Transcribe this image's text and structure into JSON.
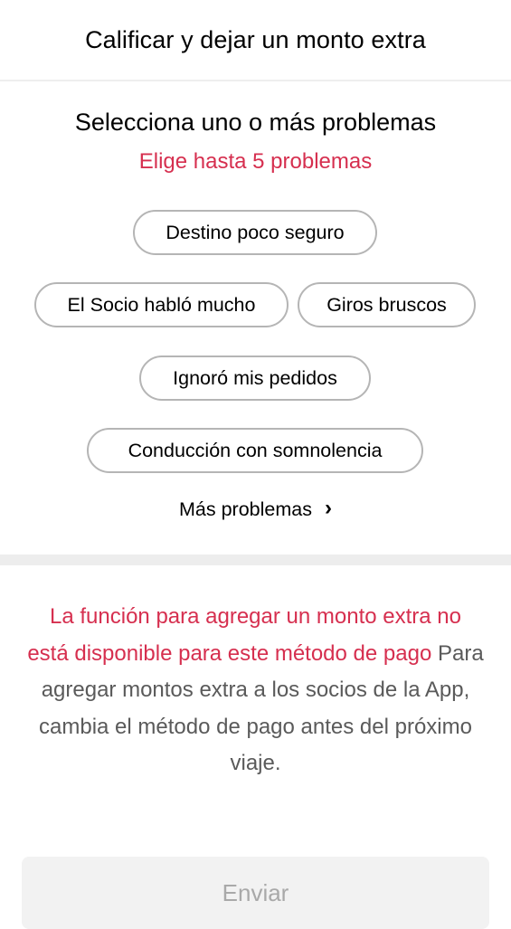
{
  "header": {
    "title": "Calificar y dejar un monto extra"
  },
  "problems": {
    "title": "Selecciona uno o más problemas",
    "subtitle": "Elige hasta 5 problemas",
    "chips": [
      "Destino poco seguro",
      "El Socio habló mucho",
      "Giros bruscos",
      "Ignoró mis pedidos",
      "Conducción con somnolencia"
    ],
    "more_label": "Más problemas",
    "more_icon": "chevron-right-icon"
  },
  "notice": {
    "warning_text": "La función para agregar un monto extra no está disponible para este método de pago",
    "info_text": " Para agregar montos extra a los socios de la App, cambia el método de pago antes del próximo viaje."
  },
  "footer": {
    "submit_label": "Enviar",
    "submit_enabled": false
  },
  "colors": {
    "accent_red": "#d62f4f",
    "chip_border": "#b5b5b5",
    "disabled_bg": "#f2f2f2",
    "disabled_text": "#a9a9a9"
  }
}
